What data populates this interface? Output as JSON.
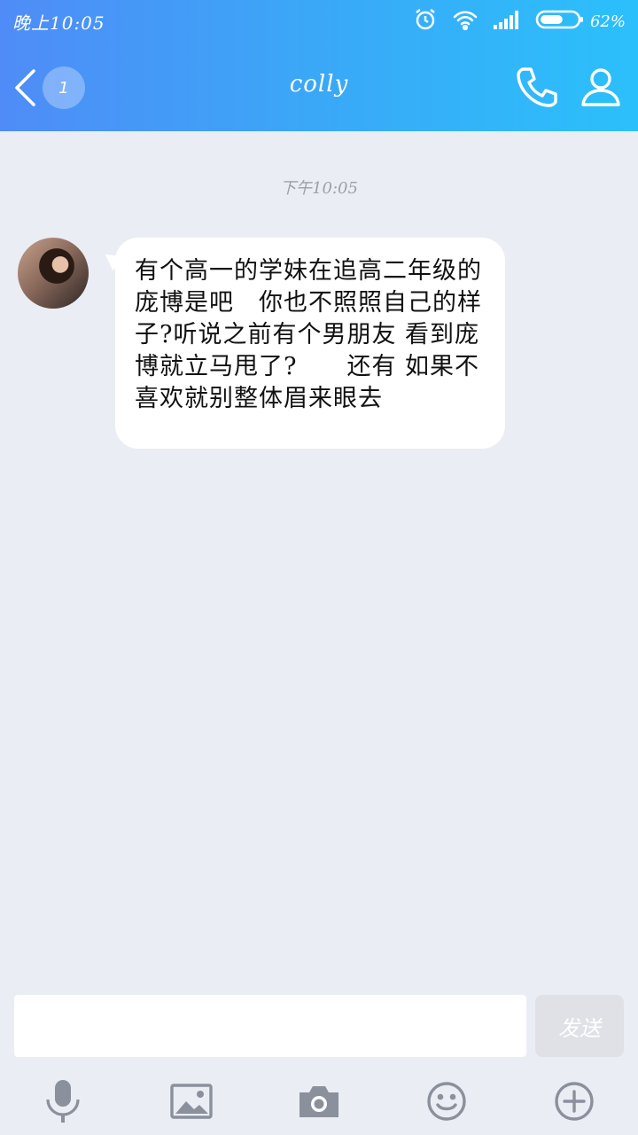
{
  "status_bar": {
    "time": "晚上10:05",
    "battery_percent": "62%",
    "battery_level": 0.62,
    "icons": [
      "alarm-icon",
      "wifi-icon",
      "signal-icon",
      "battery-icon"
    ]
  },
  "header": {
    "back_icon": "chevron-left-icon",
    "unread_badge": "1",
    "title": "colly",
    "call_icon": "phone-icon",
    "profile_icon": "user-icon"
  },
  "chat": {
    "timestamp": "下午10:05",
    "messages": [
      {
        "sender": "colly",
        "avatar_icon": "avatar-photo",
        "text": "有个高一的学妹在追高二年级的庞博是吧　你也不照照自己的样子?听说之前有个男朋友 看到庞博就立马甩了?　　还有 如果不喜欢就别整体眉来眼去"
      }
    ]
  },
  "composer": {
    "input_value": "",
    "send_label": "发送"
  },
  "toolbar": {
    "items": [
      "microphone-icon",
      "image-icon",
      "camera-icon",
      "emoji-icon",
      "plus-icon"
    ]
  },
  "colors": {
    "header_gradient_start": "#4f8cf7",
    "header_gradient_end": "#2bc0fb",
    "background": "#ebedf5",
    "bubble": "#ffffff",
    "send_button_disabled": "#dfe1e6"
  }
}
